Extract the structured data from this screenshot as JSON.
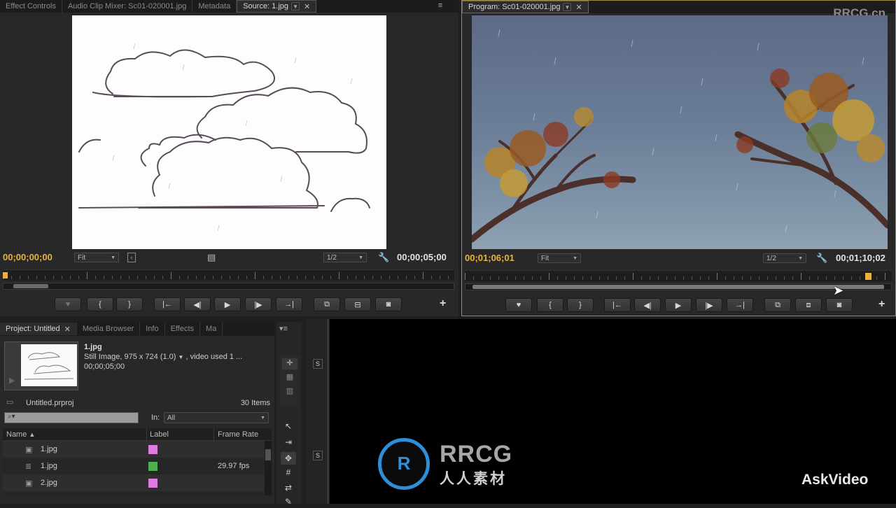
{
  "source_panel": {
    "tabs": [
      "Effect Controls",
      "Audio Clip Mixer: Sc01-020001.jpg",
      "Metadata",
      "Source: 1.jpg"
    ],
    "timecode_in": "00;00;00;00",
    "zoom": "Fit",
    "resolution": "1/2",
    "timecode_out": "00;00;05;00"
  },
  "program_panel": {
    "tab": "Program: Sc01-020001.jpg",
    "timecode_in": "00;01;06;01",
    "zoom": "Fit",
    "resolution": "1/2",
    "timecode_out": "00;01;10;02"
  },
  "project_panel": {
    "tabs": [
      "Project: Untitled",
      "Media Browser",
      "Info",
      "Effects",
      "Ma"
    ],
    "clip_name": "1.jpg",
    "clip_info": "Still Image, 975 x 724 (1.0)",
    "clip_info_extra": ", video used 1 ...",
    "clip_duration": "00;00;05;00",
    "project_file": "Untitled.prproj",
    "item_count": "30 Items",
    "search_placeholder": "",
    "in_label": "In:",
    "in_value": "All",
    "columns": {
      "name": "Name",
      "label": "Label",
      "frame_rate": "Frame Rate"
    },
    "rows": [
      {
        "name": "1.jpg",
        "color": "#e07be0",
        "frame_rate": ""
      },
      {
        "name": "1.jpg",
        "color": "#4caf50",
        "frame_rate": "29.97 fps"
      },
      {
        "name": "2.jpg",
        "color": "#e07be0",
        "frame_rate": ""
      }
    ]
  },
  "timeline": {
    "track_label_1": "S",
    "track_label_2": "S"
  },
  "watermarks": {
    "top_right": "RRCG.cn",
    "logo_line1": "RRCG",
    "logo_line2": "人人素材",
    "brand": "AskVideo"
  }
}
